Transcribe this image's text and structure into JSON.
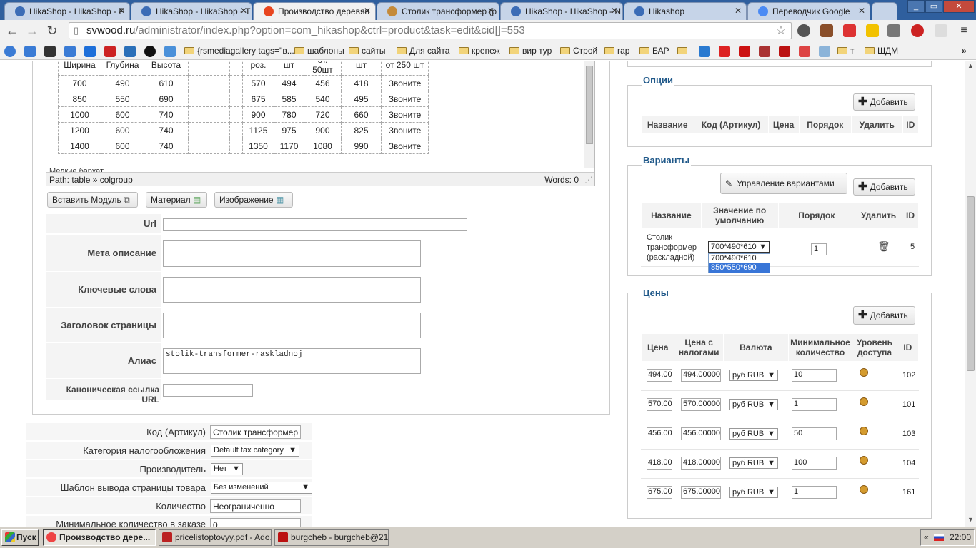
{
  "tabs": [
    {
      "label": "HikaShop - HikaShop - P",
      "active": false
    },
    {
      "label": "HikaShop - HikaShop - T",
      "active": false
    },
    {
      "label": "Производство деревян",
      "active": true
    },
    {
      "label": "Столик трансформер (р",
      "active": false
    },
    {
      "label": "HikaShop - HikaShop - N",
      "active": false
    },
    {
      "label": "Hikashop",
      "active": false
    },
    {
      "label": "Переводчик Google",
      "active": false
    }
  ],
  "address": {
    "host": "svwood.ru",
    "path": "/administrator/index.php?option=com_hikashop&ctrl=product&task=edit&cid[]=553"
  },
  "bookmarks": [
    "{rsmediagallery tags=\"в...",
    "шаблоны",
    "сайты",
    "Для сайта",
    "крепеж",
    "вир тур",
    "Строй",
    "гар",
    "БАР",
    "т",
    "ШДМ"
  ],
  "editor": {
    "header_row": [
      "Ширина",
      "Глубина",
      "Высота",
      "",
      "",
      "роз.",
      "шт",
      "от. 50шт",
      "шт",
      "от 250 шт"
    ],
    "rows": [
      [
        "700",
        "490",
        "610",
        "",
        "",
        "570",
        "494",
        "456",
        "418",
        "Звоните"
      ],
      [
        "850",
        "550",
        "690",
        "",
        "",
        "675",
        "585",
        "540",
        "495",
        "Звоните"
      ],
      [
        "1000",
        "600",
        "740",
        "",
        "",
        "900",
        "780",
        "720",
        "660",
        "Звоните"
      ],
      [
        "1200",
        "600",
        "740",
        "",
        "",
        "1125",
        "975",
        "900",
        "825",
        "Звоните"
      ],
      [
        "1400",
        "600",
        "740",
        "",
        "",
        "1350",
        "1170",
        "1080",
        "990",
        "Звоните"
      ]
    ],
    "cut_text": "Мелкие бархат...",
    "path": "Path:  table » colgroup",
    "words": "Words: 0"
  },
  "editor_buttons": {
    "module": "Вставить Модуль",
    "material": "Материал",
    "image": "Изображение"
  },
  "meta": {
    "url_label": "Url",
    "url_value": "",
    "meta_desc_label": "Мета описание",
    "keywords_label": "Ключевые слова",
    "page_title_label": "Заголовок страницы",
    "alias_label": "Алиас",
    "alias_value": "stolik-transformer-raskladnoj",
    "canonical_label": "Каноническая ссылка URL"
  },
  "product": {
    "code_label": "Код (Артикул)",
    "code_value": "Столик трансформер (ра",
    "tax_label": "Категория налогообложения",
    "tax_value": "Default tax category",
    "manufacturer_label": "Производитель",
    "manufacturer_value": "Нет",
    "template_label": "Шаблон вывода страницы товара",
    "template_value": "Без изменений",
    "quantity_label": "Количество",
    "quantity_value": "Неограниченно",
    "min_qty_label": "Минимальное количество в заказе",
    "min_qty_value": "0"
  },
  "options": {
    "legend": "Опции",
    "add": "Добавить",
    "headers": [
      "Название",
      "Код (Артикул)",
      "Цена",
      "Порядок",
      "Удалить",
      "ID"
    ]
  },
  "variants": {
    "legend": "Варианты",
    "manage": "Управление вариантами",
    "add": "Добавить",
    "headers": [
      "Название",
      "Значение по умолчанию",
      "Порядок",
      "Удалить",
      "ID"
    ],
    "row": {
      "name": "Столик трансформер (раскладной)",
      "selected": "700*490*610",
      "order": "1",
      "id": "5"
    },
    "dropdown": [
      "700*490*610",
      "850*550*690"
    ]
  },
  "prices": {
    "legend": "Цены",
    "add": "Добавить",
    "headers": [
      "Цена",
      "Цена с налогами",
      "Валюта",
      "Минимальное количество",
      "Уровень доступа",
      "ID"
    ],
    "rows": [
      {
        "price": "494.00",
        "price_tax": "494.00000",
        "currency": "руб RUB",
        "min": "10",
        "id": "102"
      },
      {
        "price": "570.00",
        "price_tax": "570.00000",
        "currency": "руб RUB",
        "min": "1",
        "id": "101"
      },
      {
        "price": "456.00",
        "price_tax": "456.00000",
        "currency": "руб RUB",
        "min": "50",
        "id": "103"
      },
      {
        "price": "418.00",
        "price_tax": "418.00000",
        "currency": "руб RUB",
        "min": "100",
        "id": "104"
      },
      {
        "price": "675.00",
        "price_tax": "675.00000",
        "currency": "руб RUB",
        "min": "1",
        "id": "161"
      }
    ]
  },
  "taskbar": {
    "start": "Пуск",
    "items": [
      "Производство дере...",
      "pricelistoptovyy.pdf - Ado...",
      "burgcheb - burgcheb@21..."
    ],
    "time": "22:00"
  },
  "colors": {
    "accent": "#1f5889",
    "tabbar": "#2f5f9e"
  }
}
